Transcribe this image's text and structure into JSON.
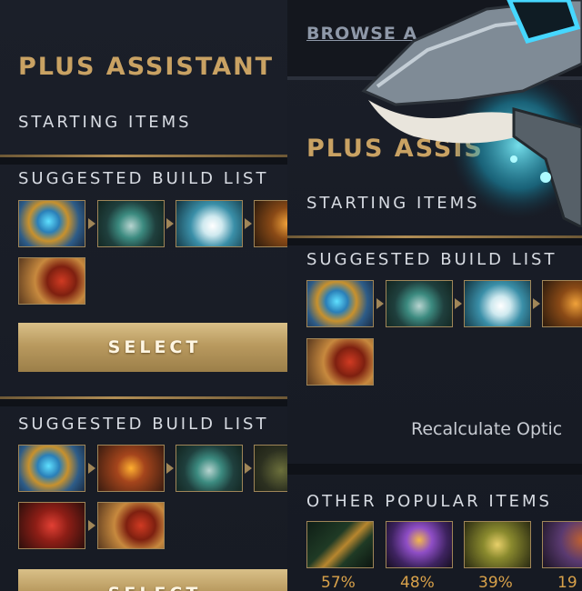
{
  "left_panel": {
    "title": "PLUS ASSISTANT",
    "starting_items_label": "STARTING ITEMS",
    "build_1": {
      "label": "SUGGESTED BUILD LIST",
      "items": [
        "arcane-boots-icon",
        "phase-boots-icon",
        "blade-icon",
        "helm-icon",
        "red-boots-icon"
      ],
      "select_label": "SELECT"
    },
    "build_2": {
      "label": "SUGGESTED BUILD LIST",
      "items": [
        "arcane-boots-icon",
        "shield-icon",
        "phase-boots-icon",
        "wisp-icon",
        "red-orb-icon",
        "red-boots-icon"
      ],
      "select_label": "SELECT"
    }
  },
  "right_panel": {
    "browse_label": "BROWSE A",
    "title": "PLUS ASSIS",
    "starting_items_label": "STARTING ITEMS",
    "build_label": "SUGGESTED BUILD LIST",
    "build_items": [
      "arcane-boots-icon",
      "phase-boots-icon",
      "blade-icon",
      "helm-icon",
      "red-boots-icon"
    ],
    "recalculate_label": "Recalculate Optic",
    "other_popular_label": "OTHER POPULAR ITEMS",
    "popular_items": [
      {
        "icon": "staff-icon",
        "percent": "57%"
      },
      {
        "icon": "mage-icon",
        "percent": "48%"
      },
      {
        "icon": "mech-icon",
        "percent": "39%"
      },
      {
        "icon": "part-icon",
        "percent": "19"
      }
    ]
  },
  "colors": {
    "gold": "#c9a263",
    "pct": "#d9a24a",
    "bg": "#171b24"
  }
}
